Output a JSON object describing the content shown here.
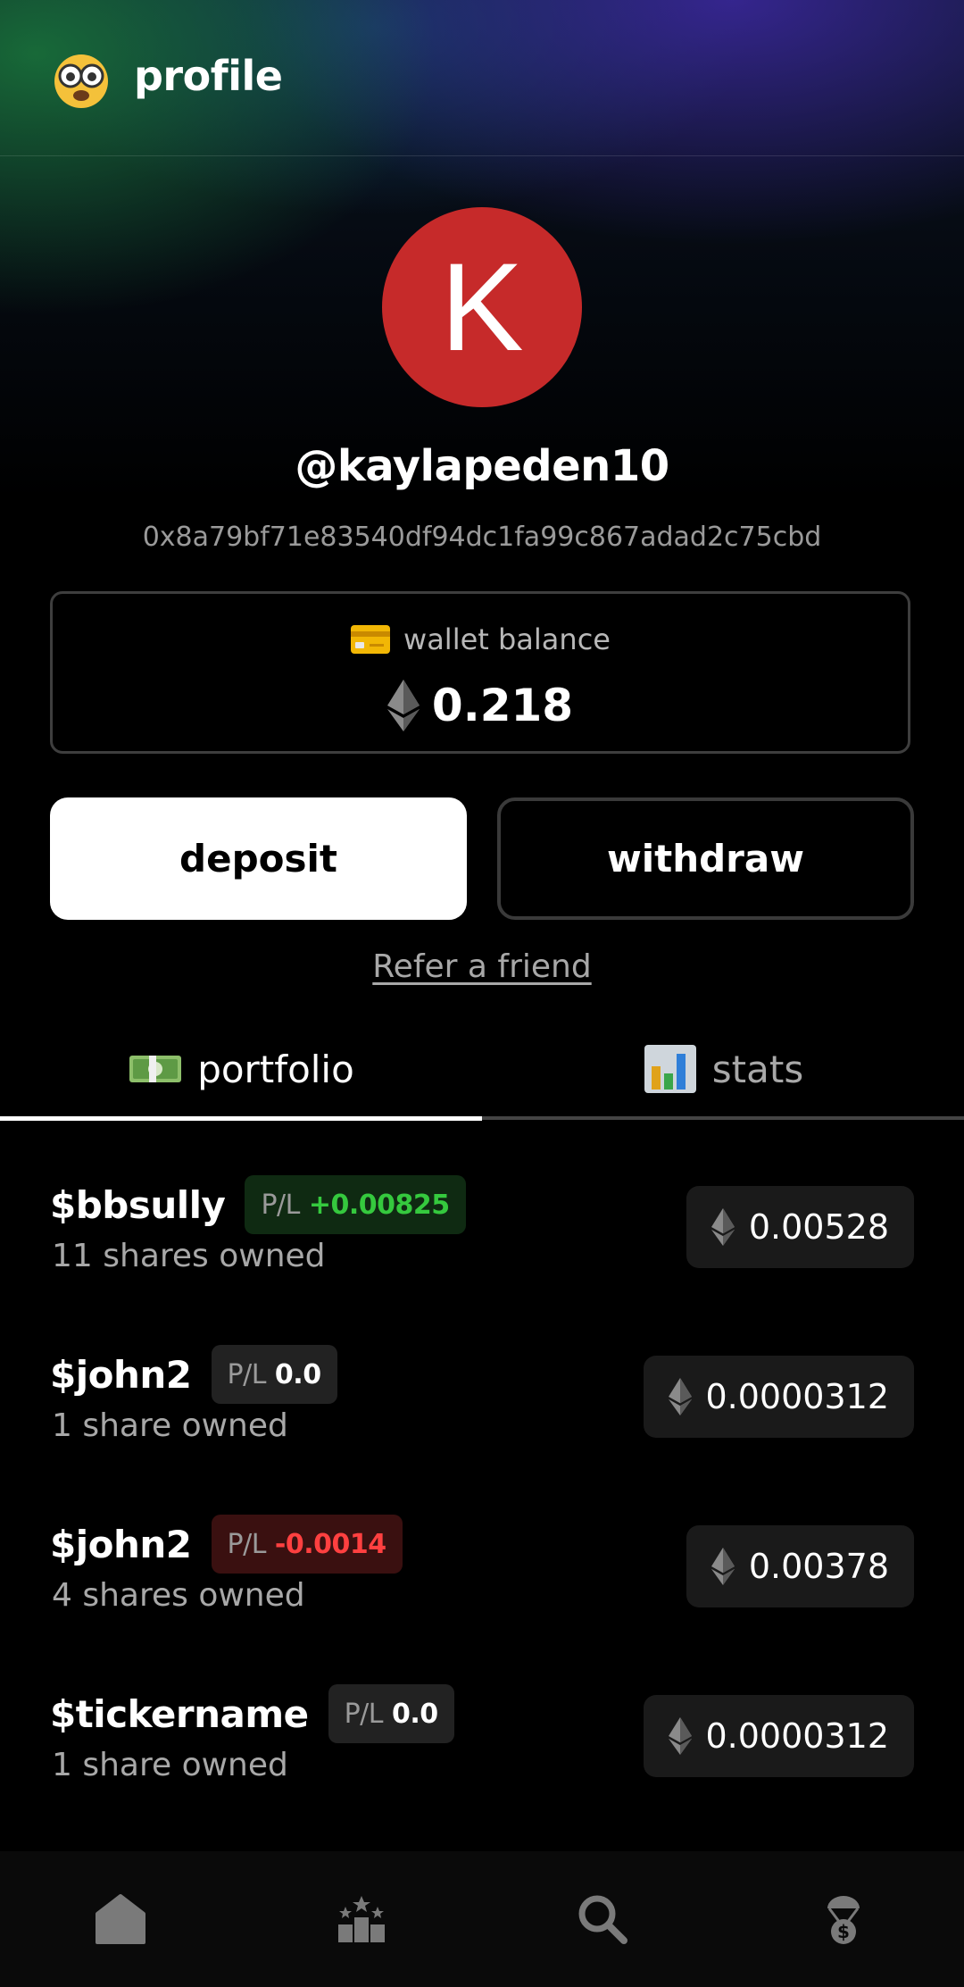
{
  "header": {
    "title": "profile",
    "icon": "nerd-face-icon"
  },
  "profile": {
    "avatar_initial": "K",
    "avatar_color": "#c62a2a",
    "username": "@kaylapeden10",
    "address": "0x8a79bf71e83540df94dc1fa99c867adad2c75cbd"
  },
  "wallet": {
    "label": "wallet balance",
    "value": "0.218",
    "icon": "credit-card-icon"
  },
  "actions": {
    "deposit": "deposit",
    "withdraw": "withdraw",
    "refer": "Refer a friend"
  },
  "tabs": [
    {
      "label": "portfolio",
      "icon": "money-bill-icon",
      "active": true
    },
    {
      "label": "stats",
      "icon": "bar-chart-icon",
      "active": false
    }
  ],
  "holdings": [
    {
      "ticker": "$bbsully",
      "pl_label": "P/L",
      "pl_value": "+0.00825",
      "pl_status": "positive",
      "shares": "11 shares owned",
      "price": "0.00528"
    },
    {
      "ticker": "$john2",
      "pl_label": "P/L",
      "pl_value": "0.0",
      "pl_status": "neutral",
      "shares": "1 share owned",
      "price": "0.0000312"
    },
    {
      "ticker": "$john2",
      "pl_label": "P/L",
      "pl_value": "-0.0014",
      "pl_status": "negative",
      "shares": "4 shares owned",
      "price": "0.00378"
    },
    {
      "ticker": "$tickername",
      "pl_label": "P/L",
      "pl_value": "0.0",
      "pl_status": "neutral",
      "shares": "1 share owned",
      "price": "0.0000312"
    }
  ],
  "nav": [
    "home-icon",
    "leaderboard-icon",
    "search-icon",
    "airdrop-icon"
  ],
  "colors": {
    "positive": "#35c93e",
    "negative": "#ff4040",
    "background": "#000000"
  }
}
